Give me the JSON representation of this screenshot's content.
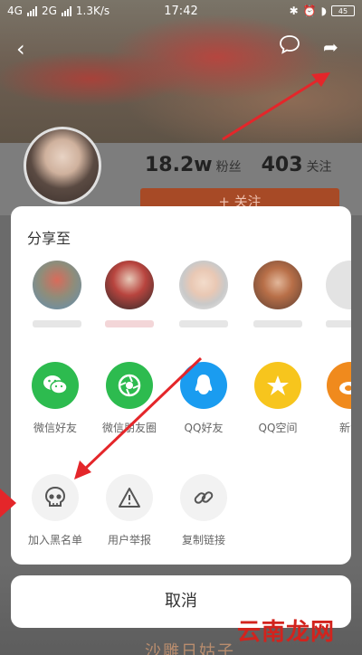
{
  "status_bar": {
    "net1": "4G",
    "net2": "2G",
    "speed": "1.3K/s",
    "time": "17:42",
    "battery": "45"
  },
  "profile": {
    "fans_count": "18.2w",
    "fans_label": "粉丝",
    "follow_count": "403",
    "follow_label": "关注",
    "follow_button": "+ 关注",
    "bottom_text": "沙雕日姑子"
  },
  "share_sheet": {
    "title": "分享至",
    "apps": [
      {
        "label": "微信好友",
        "icon": "wechat-icon",
        "color": "#2dbb4f"
      },
      {
        "label": "微信朋友圈",
        "icon": "moments-icon",
        "color": "#2dbb4f"
      },
      {
        "label": "QQ好友",
        "icon": "qq-icon",
        "color": "#1a9cf0"
      },
      {
        "label": "QQ空间",
        "icon": "qzone-icon",
        "color": "#f7c51d"
      },
      {
        "label": "新浪",
        "icon": "weibo-icon",
        "color": "#f08a1d"
      }
    ],
    "tools": [
      {
        "label": "加入黑名单",
        "icon": "skull-icon"
      },
      {
        "label": "用户举报",
        "icon": "warning-icon"
      },
      {
        "label": "复制链接",
        "icon": "link-icon"
      }
    ],
    "cancel": "取消"
  },
  "watermark": "云南龙网",
  "colors": {
    "wechat": "#2dbb4f",
    "qq": "#1a9cf0",
    "qzone": "#f7c51d",
    "weibo": "#f08a1d",
    "annotation_arrow": "#e4262a",
    "follow_button": "#a74a26"
  }
}
